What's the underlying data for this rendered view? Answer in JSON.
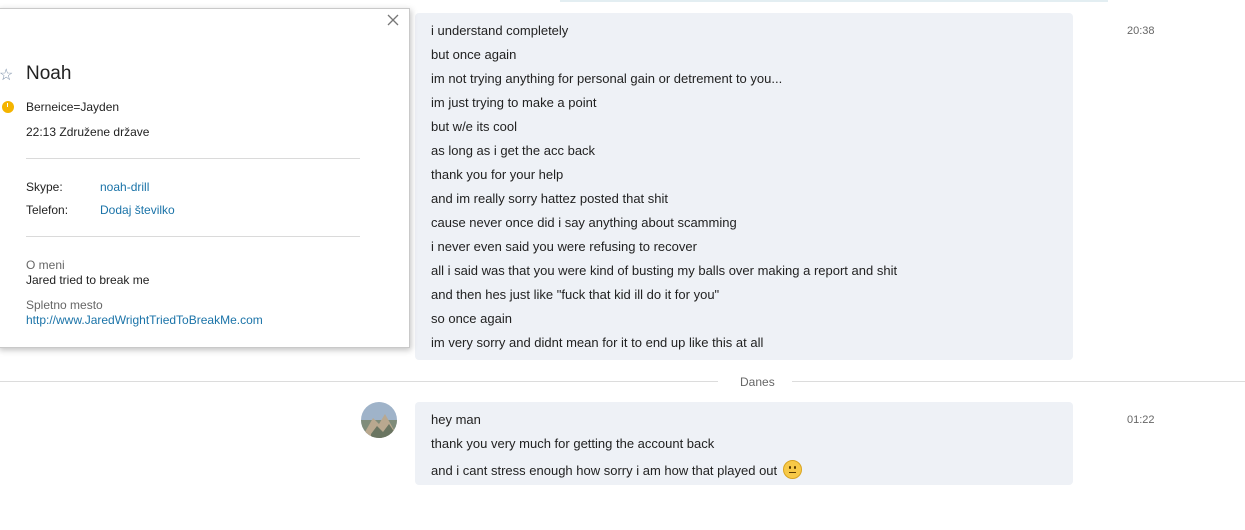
{
  "conversation": {
    "block1": {
      "time": "20:38",
      "lines": [
        "i understand completely",
        "but once again",
        "im not trying anything for personal gain or detrement to you...",
        "im just trying to make a point",
        "but w/e its cool",
        "as long as i get the acc back",
        "thank you for your help",
        "and im really sorry hattez posted that shit",
        "cause never once did i say anything about scamming",
        "i never even said you were refusing to recover",
        "all i said was that you were kind of busting my balls over making a report and shit",
        "and then hes just like \"fuck that kid ill do it for you\"",
        "so once again",
        "im very sorry and didnt mean for it to end up like this at all"
      ]
    },
    "divider_label": "Danes",
    "block2": {
      "time": "01:22",
      "lines": [
        "hey man",
        "thank you very much for getting the account back",
        "and i cant stress enough how sorry i am how that played out"
      ],
      "emoji": "confused-face-emoji"
    }
  },
  "profile_card": {
    "name": "Noah",
    "mood": "Berneice=Jayden",
    "local_time": "22:13 Združene države",
    "skype_label": "Skype:",
    "skype_value": "noah-drill",
    "phone_label": "Telefon:",
    "phone_value": "Dodaj številko",
    "about_label": "O meni",
    "about_value": "Jared tried to break me",
    "website_label": "Spletno mesto",
    "website_value": "http://www.JaredWrightTriedToBreakMe.com",
    "status_color": "#f4b400",
    "link_color": "#1a73a8"
  },
  "colors": {
    "bubble_bg": "#eef1f6",
    "divider": "#dcdcdc"
  }
}
